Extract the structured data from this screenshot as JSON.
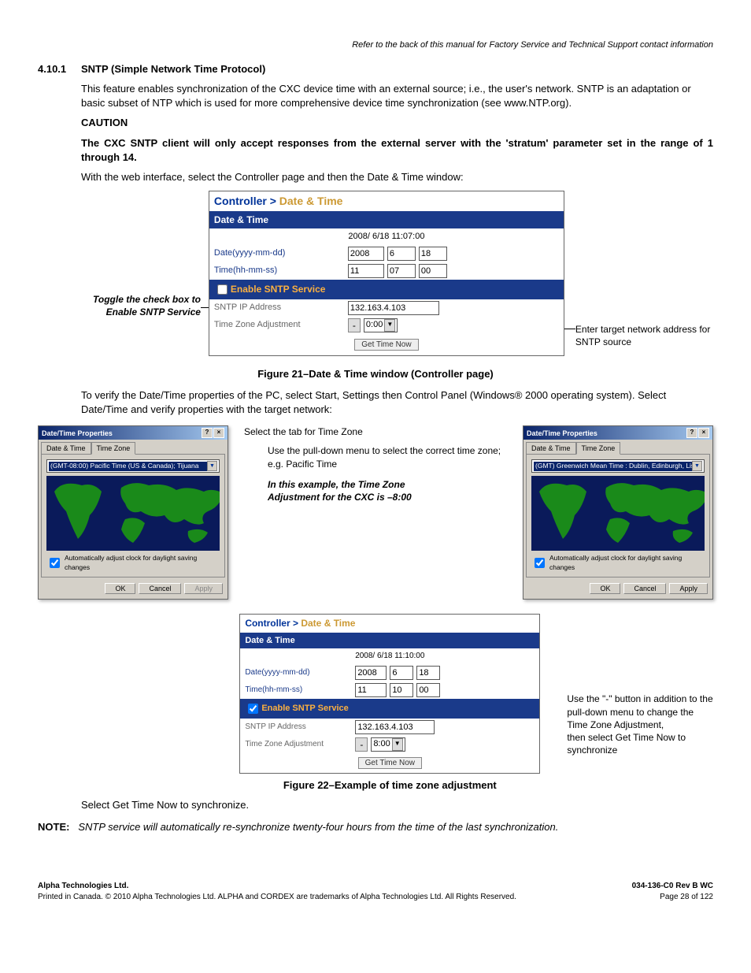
{
  "header_note": "Refer to the back of this manual for Factory Service and Technical Support contact information",
  "section": {
    "num": "4.10.1",
    "title": "SNTP (Simple Network Time Protocol)"
  },
  "p1": "This feature enables synchronization of the CXC device time with an external source; i.e., the user's network. SNTP is an adaptation or basic subset of NTP which is used for more comprehensive device time synchronization (see www.NTP.org).",
  "caution_label": "CAUTION",
  "caution_body": "The CXC SNTP client will only accept responses from the external server with the 'stratum' parameter set in the range of 1 through 14.",
  "p2": "With the web interface, select the Controller page and then the Date & Time window:",
  "callout_left_1": "Toggle the check box to",
  "callout_left_2": "Enable SNTP Service",
  "callout_right": "Enter target network address for SNTP source",
  "webshot1": {
    "bc1": "Controller >",
    "bc2": "Date & Time",
    "band1": "Date & Time",
    "timestamp": "2008/ 6/18 11:07:00",
    "date_label": "Date(yyyy-mm-dd)",
    "time_label": "Time(hh-mm-ss)",
    "date": {
      "y": "2008",
      "m": "6",
      "d": "18"
    },
    "time": {
      "h": "11",
      "mi": "07",
      "s": "00"
    },
    "chk_label": "Enable SNTP Service",
    "ip_label": "SNTP IP Address",
    "ip": "132.163.4.103",
    "tz_label": "Time Zone Adjustment",
    "tz": "0:00",
    "btn": "Get Time Now"
  },
  "fig21": "Figure 21–Date & Time window (Controller page)",
  "p3": "To verify the Date/Time properties of the PC, select Start, Settings then Control Panel (Windows® 2000 operating system). Select Date/Time and verify properties with the target network:",
  "windlg": {
    "title": "Date/Time Properties",
    "tab1": "Date & Time",
    "tab2": "Time Zone",
    "tz_left": "(GMT-08:00) Pacific Time (US & Canada); Tijuana",
    "tz_right": "(GMT) Greenwich Mean Time : Dublin, Edinburgh, Lisbon, London",
    "dst": "Automatically adjust clock for daylight saving changes",
    "ok": "OK",
    "cancel": "Cancel",
    "apply": "Apply"
  },
  "mid": {
    "l1": "Select the tab for Time Zone",
    "l2": "Use the pull-down menu to select the correct time zone; e.g. Pacific Time",
    "l3a": "In this example, the Time Zone",
    "l3b": "Adjustment for the CXC is –8:00"
  },
  "webshot2": {
    "bc1": "Controller >",
    "bc2": "Date & Time",
    "band1": "Date & Time",
    "timestamp": "2008/ 6/18 11:10:00",
    "date_label": "Date(yyyy-mm-dd)",
    "time_label": "Time(hh-mm-ss)",
    "date": {
      "y": "2008",
      "m": "6",
      "d": "18"
    },
    "time": {
      "h": "11",
      "mi": "10",
      "s": "00"
    },
    "chk_label": "Enable SNTP Service",
    "ip_label": "SNTP IP Address",
    "ip": "132.163.4.103",
    "tz_label": "Time Zone Adjustment",
    "tz": "8:00",
    "btn": "Get Time Now"
  },
  "callout_right2": "Use the \"-\" button in addition to the pull-down menu to change the Time Zone Adjustment,\nthen select Get Time Now to synchronize",
  "fig22": "Figure 22–Example of time zone adjustment",
  "p4": "Select Get Time Now to synchronize.",
  "note_label": "NOTE:",
  "note_body": "SNTP service will automatically re-synchronize twenty-four hours from the time of the last synchronization.",
  "footer": {
    "company": "Alpha Technologies Ltd.",
    "copyright": "Printed in Canada.  © 2010 Alpha Technologies Ltd.  ALPHA and CORDEX are trademarks of Alpha Technologies Ltd.  All Rights Reserved.",
    "docnum": "034-136-C0  Rev B  WC",
    "page": "Page 28 of 122"
  }
}
